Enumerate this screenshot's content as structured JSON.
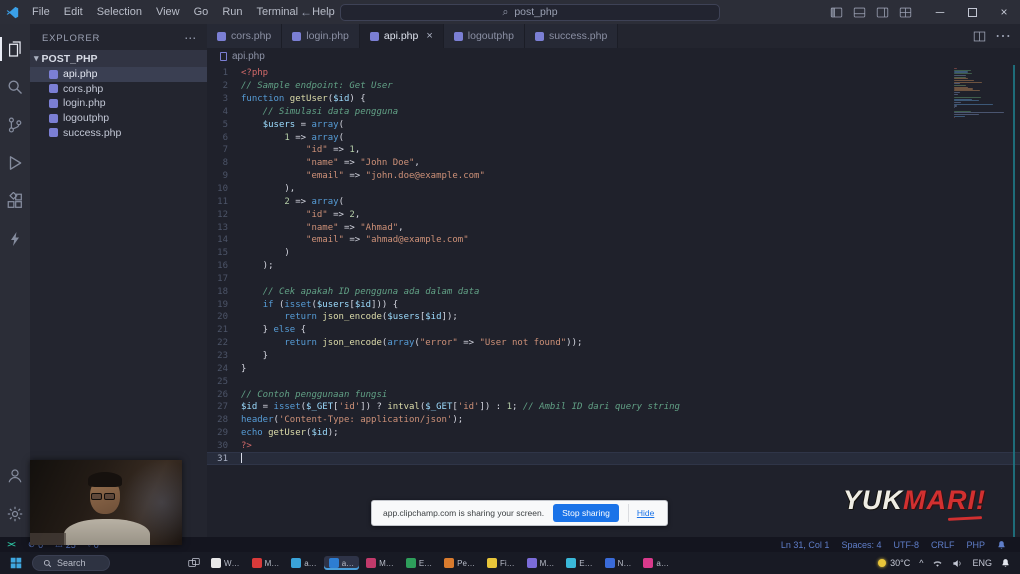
{
  "icons": {
    "back": "←",
    "forward": "→",
    "chevron_down": "▾",
    "ellipsis": "⋯",
    "error": "⊘",
    "warning": "⚠",
    "remote": "><",
    "close": "×",
    "minimize": "─",
    "chevron_up": "^",
    "search_glyph": "⌕"
  },
  "titlebar": {
    "menus": [
      "File",
      "Edit",
      "Selection",
      "View",
      "Go",
      "Run",
      "Terminal",
      "Help"
    ],
    "search_value": "post_php"
  },
  "sidebar": {
    "header": "EXPLORER",
    "folder": "POST_PHP",
    "files": [
      {
        "name": "api.php",
        "selected": true
      },
      {
        "name": "cors.php"
      },
      {
        "name": "login.php"
      },
      {
        "name": "logoutphp"
      },
      {
        "name": "success.php"
      }
    ]
  },
  "tabs": [
    {
      "label": "cors.php"
    },
    {
      "label": "login.php"
    },
    {
      "label": "api.php",
      "active": true
    },
    {
      "label": "logoutphp"
    },
    {
      "label": "success.php"
    }
  ],
  "breadcrumb": {
    "file": "api.php"
  },
  "editor": {
    "lines": [
      [
        [
          "tag",
          "<?php"
        ]
      ],
      [
        [
          "cm",
          "// Sample endpoint: Get User"
        ]
      ],
      [
        [
          "kw",
          "function"
        ],
        [
          "pun",
          " "
        ],
        [
          "fn",
          "getUser"
        ],
        [
          "pun",
          "("
        ],
        [
          "var",
          "$id"
        ],
        [
          "pun",
          ") {"
        ]
      ],
      [
        [
          "cm",
          "    // Simulasi data pengguna"
        ]
      ],
      [
        [
          "pun",
          "    "
        ],
        [
          "var",
          "$users"
        ],
        [
          "pun",
          " = "
        ],
        [
          "kw",
          "array"
        ],
        [
          "pun",
          "("
        ]
      ],
      [
        [
          "pun",
          "        "
        ],
        [
          "num",
          "1"
        ],
        [
          "pun",
          " => "
        ],
        [
          "kw",
          "array"
        ],
        [
          "pun",
          "("
        ]
      ],
      [
        [
          "pun",
          "            "
        ],
        [
          "str",
          "\"id\""
        ],
        [
          "pun",
          " => "
        ],
        [
          "num",
          "1"
        ],
        [
          "pun",
          ","
        ]
      ],
      [
        [
          "pun",
          "            "
        ],
        [
          "str",
          "\"name\""
        ],
        [
          "pun",
          " => "
        ],
        [
          "str",
          "\"John Doe\""
        ],
        [
          "pun",
          ","
        ]
      ],
      [
        [
          "pun",
          "            "
        ],
        [
          "str",
          "\"email\""
        ],
        [
          "pun",
          " => "
        ],
        [
          "str",
          "\"john.doe@example.com\""
        ]
      ],
      [
        [
          "pun",
          "        ),"
        ]
      ],
      [
        [
          "pun",
          "        "
        ],
        [
          "num",
          "2"
        ],
        [
          "pun",
          " => "
        ],
        [
          "kw",
          "array"
        ],
        [
          "pun",
          "("
        ]
      ],
      [
        [
          "pun",
          "            "
        ],
        [
          "str",
          "\"id\""
        ],
        [
          "pun",
          " => "
        ],
        [
          "num",
          "2"
        ],
        [
          "pun",
          ","
        ]
      ],
      [
        [
          "pun",
          "            "
        ],
        [
          "str",
          "\"name\""
        ],
        [
          "pun",
          " => "
        ],
        [
          "str",
          "\"Ahmad\""
        ],
        [
          "pun",
          ","
        ]
      ],
      [
        [
          "pun",
          "            "
        ],
        [
          "str",
          "\"email\""
        ],
        [
          "pun",
          " => "
        ],
        [
          "str",
          "\"ahmad@example.com\""
        ]
      ],
      [
        [
          "pun",
          "        )"
        ]
      ],
      [
        [
          "pun",
          "    );"
        ]
      ],
      [],
      [
        [
          "pun",
          "    "
        ],
        [
          "cm",
          "// Cek apakah ID pengguna ada dalam data"
        ]
      ],
      [
        [
          "pun",
          "    "
        ],
        [
          "kw",
          "if"
        ],
        [
          "pun",
          " ("
        ],
        [
          "kw",
          "isset"
        ],
        [
          "pun",
          "("
        ],
        [
          "var",
          "$users"
        ],
        [
          "pun",
          "["
        ],
        [
          "var",
          "$id"
        ],
        [
          "pun",
          "])) {"
        ]
      ],
      [
        [
          "pun",
          "        "
        ],
        [
          "kw",
          "return"
        ],
        [
          "pun",
          " "
        ],
        [
          "fn",
          "json_encode"
        ],
        [
          "pun",
          "("
        ],
        [
          "var",
          "$users"
        ],
        [
          "pun",
          "["
        ],
        [
          "var",
          "$id"
        ],
        [
          "pun",
          "]);"
        ]
      ],
      [
        [
          "pun",
          "    } "
        ],
        [
          "kw",
          "else"
        ],
        [
          "pun",
          " {"
        ]
      ],
      [
        [
          "pun",
          "        "
        ],
        [
          "kw",
          "return"
        ],
        [
          "pun",
          " "
        ],
        [
          "fn",
          "json_encode"
        ],
        [
          "pun",
          "("
        ],
        [
          "kw",
          "array"
        ],
        [
          "pun",
          "("
        ],
        [
          "str",
          "\"error\""
        ],
        [
          "pun",
          " => "
        ],
        [
          "str",
          "\"User not found\""
        ],
        [
          "pun",
          "));"
        ]
      ],
      [
        [
          "pun",
          "    }"
        ]
      ],
      [
        [
          "pun",
          "}"
        ]
      ],
      [],
      [
        [
          "cm",
          "// Contoh penggunaan fungsi"
        ]
      ],
      [
        [
          "var",
          "$id"
        ],
        [
          "pun",
          " = "
        ],
        [
          "kw",
          "isset"
        ],
        [
          "pun",
          "("
        ],
        [
          "var",
          "$_GET"
        ],
        [
          "pun",
          "["
        ],
        [
          "str",
          "'id'"
        ],
        [
          "pun",
          "]) ? "
        ],
        [
          "fn",
          "intval"
        ],
        [
          "pun",
          "("
        ],
        [
          "var",
          "$_GET"
        ],
        [
          "pun",
          "["
        ],
        [
          "str",
          "'id'"
        ],
        [
          "pun",
          "]) : "
        ],
        [
          "num",
          "1"
        ],
        [
          "pun",
          "; "
        ],
        [
          "cm",
          "// Ambil ID dari query string"
        ]
      ],
      [
        [
          "bi",
          "header"
        ],
        [
          "pun",
          "("
        ],
        [
          "str",
          "'Content-Type: application/json'"
        ],
        [
          "pun",
          ");"
        ]
      ],
      [
        [
          "kw",
          "echo"
        ],
        [
          "pun",
          " "
        ],
        [
          "fn",
          "getUser"
        ],
        [
          "pun",
          "("
        ],
        [
          "var",
          "$id"
        ],
        [
          "pun",
          ");"
        ]
      ],
      [
        [
          "tag",
          "?>"
        ]
      ],
      []
    ]
  },
  "status_bar": {
    "errors": "0",
    "warnings": "25",
    "ports": "0",
    "line_col": "Ln 31, Col 1",
    "spaces": "Spaces: 4",
    "encoding": "UTF-8",
    "eol": "CRLF",
    "language": "PHP"
  },
  "share_bar": {
    "message": "app.clipchamp.com is sharing your screen.",
    "stop_button": "Stop sharing",
    "hide_link": "Hide"
  },
  "watermark": {
    "primary": "YUK",
    "accent": "MARI!"
  },
  "taskbar": {
    "search_label": "Search",
    "weather": "30°C",
    "language": "ENG",
    "apps": [
      {
        "label": "W…",
        "color": "#e8e8e8"
      },
      {
        "label": "M…",
        "color": "#d93a3a"
      },
      {
        "label": "a…",
        "color": "#3aa3d9"
      },
      {
        "label": "a…",
        "color": "#2d7dd2",
        "active": true
      },
      {
        "label": "M…",
        "color": "#c23a6b"
      },
      {
        "label": "E…",
        "color": "#2e9e5b"
      },
      {
        "label": "Pe…",
        "color": "#d97b2e"
      },
      {
        "label": "Fi…",
        "color": "#e8c53a"
      },
      {
        "label": "M…",
        "color": "#7b6cd9"
      },
      {
        "label": "E…",
        "color": "#3ab8d9"
      },
      {
        "label": "N…",
        "color": "#3a6bd9"
      },
      {
        "label": "a…",
        "color": "#d93a8c"
      }
    ]
  }
}
